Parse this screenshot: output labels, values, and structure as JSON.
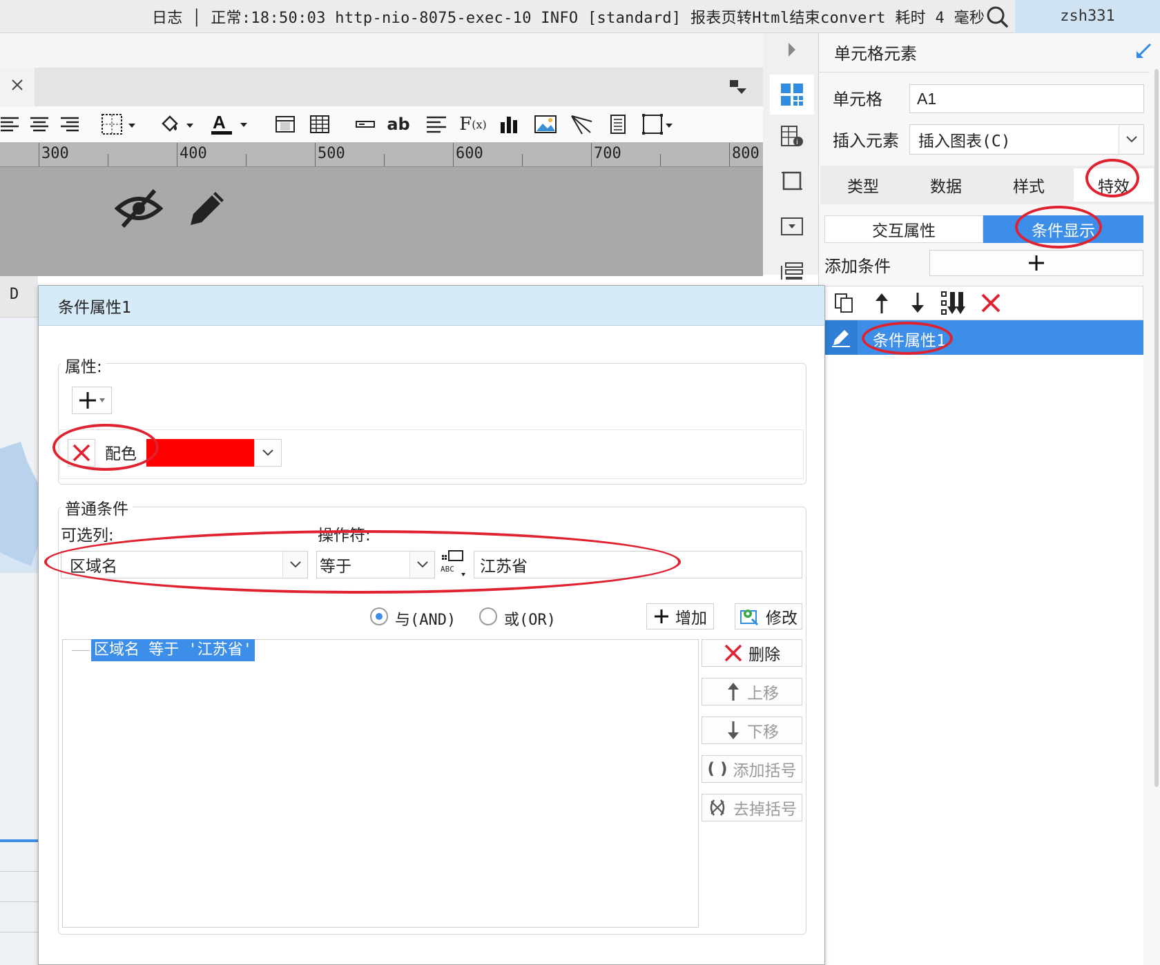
{
  "topbar": {
    "log_text": "日志 │ 正常:18:50:03 http-nio-8075-exec-10 INFO [standard] 报表页转Html结束convert  耗时 4 毫秒",
    "user": "zsh331"
  },
  "ruler": {
    "labels": [
      "300",
      "400",
      "500",
      "600",
      "700",
      "800"
    ]
  },
  "column_letter": "D",
  "right_panel": {
    "title": "单元格元素",
    "cell_label": "单元格",
    "cell_value": "A1",
    "insert_label": "插入元素",
    "insert_value": "插入图表(C)",
    "tabs": [
      "类型",
      "数据",
      "样式",
      "特效"
    ],
    "active_tab": "特效",
    "subtabs": [
      "交互属性",
      "条件显示"
    ],
    "active_subtab": "条件显示",
    "add_condition_label": "添加条件",
    "list_item": "条件属性1"
  },
  "dialog": {
    "title": "条件属性1",
    "property_legend": "属性:",
    "property_name": "配色",
    "property_color": "#ff0000",
    "condition_legend": "普通条件",
    "column_label": "可选列:",
    "operator_label": "操作符:",
    "column_value": "区域名",
    "operator_value": "等于",
    "value_input": "江苏省",
    "and_label": "与(AND)",
    "or_label": "或(OR)",
    "add_button": "增加",
    "modify_button": "修改",
    "condition_expression": "区域名 等于 '江苏省'",
    "delete_button": "删除",
    "move_up_button": "上移",
    "move_down_button": "下移",
    "add_bracket_button": "添加括号",
    "remove_bracket_button": "去掉括号"
  },
  "colors": {
    "accent": "#3d8ee8",
    "highlight_red": "#e0212f",
    "title_bar": "#d5ebf7"
  }
}
